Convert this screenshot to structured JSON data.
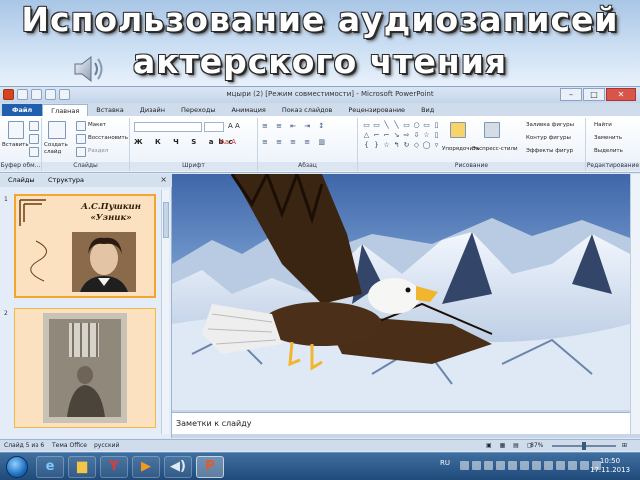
{
  "slide": {
    "title_line1": "Использование аудиозаписей",
    "title_line2": "актерского чтения"
  },
  "window": {
    "title": "мцыри (2) [Режим совместимости] - Microsoft PowerPoint"
  },
  "tabs": [
    {
      "label": "Файл"
    },
    {
      "label": "Главная"
    },
    {
      "label": "Вставка"
    },
    {
      "label": "Дизайн"
    },
    {
      "label": "Переходы"
    },
    {
      "label": "Анимация"
    },
    {
      "label": "Показ слайдов"
    },
    {
      "label": "Рецензирование"
    },
    {
      "label": "Вид"
    }
  ],
  "ribbon": {
    "groups": {
      "clipboard": "Буфер обм...",
      "slides": "Слайды",
      "font": "Шрифт",
      "paragraph": "Абзац",
      "drawing": "Рисование",
      "editing": "Редактирование"
    },
    "buttons": {
      "paste": "Вставить",
      "create_slide": "Создать слайд",
      "layout": "Макет",
      "restore": "Восстановить",
      "section": "Раздел",
      "arrange": "Упорядочить",
      "quick_styles": "Экспресс-стили",
      "shape_fill": "Заливка фигуры",
      "shape_outline": "Контур фигуры",
      "shape_effects": "Эффекты фигур",
      "find": "Найти",
      "replace": "Заменить",
      "select": "Выделить"
    }
  },
  "slides_pane": {
    "tab_slides": "Слайды",
    "tab_structure": "Структура",
    "close": "×",
    "thumbs": [
      {
        "num": "1",
        "title": "А.С.Пушкин «Узник»"
      },
      {
        "num": "2"
      }
    ]
  },
  "notes": {
    "placeholder": "Заметки к слайду"
  },
  "status": {
    "slide_info": "Слайд 5 из 6",
    "theme": "Тема Office",
    "language": "русский",
    "zoom": "87%"
  },
  "taskbar": {
    "lang": "RU",
    "time": "10:50",
    "date": "17.11.2013"
  }
}
